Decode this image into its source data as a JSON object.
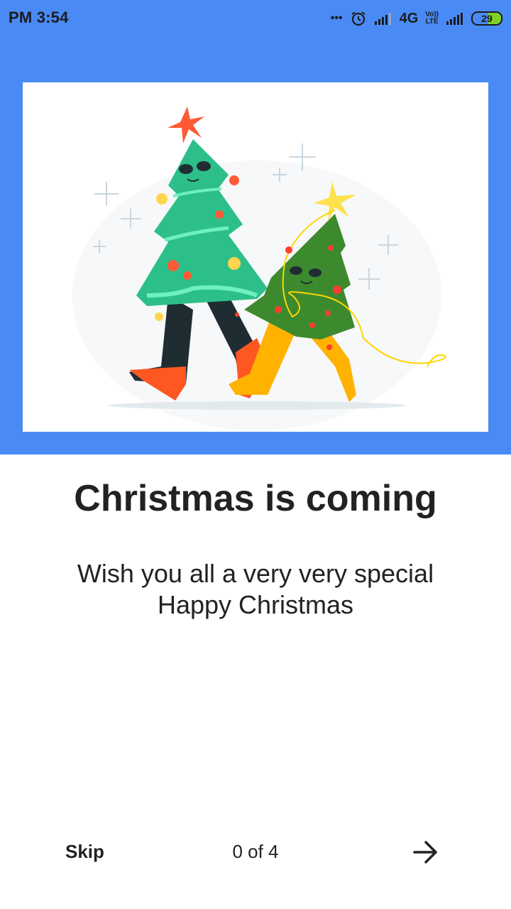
{
  "status_bar": {
    "time": "PM 3:54",
    "dots": "•••",
    "network": "4G",
    "volte_top": "Vo))",
    "volte_bottom": "LTE",
    "battery": "29",
    "icons": [
      "alarm-icon",
      "signal-icon",
      "signal-icon",
      "battery-icon"
    ]
  },
  "onboarding": {
    "illustration": "christmas-trees-walking",
    "title": "Christmas is coming",
    "subtitle_line1": "Wish you all a very very special",
    "subtitle_line2": "Happy Christmas"
  },
  "footer": {
    "skip_label": "Skip",
    "page_indicator": "0 of 4",
    "next_icon": "arrow-right-icon"
  },
  "colors": {
    "accent": "#4a8af4",
    "text": "#222222",
    "battery": "#7ed321"
  }
}
